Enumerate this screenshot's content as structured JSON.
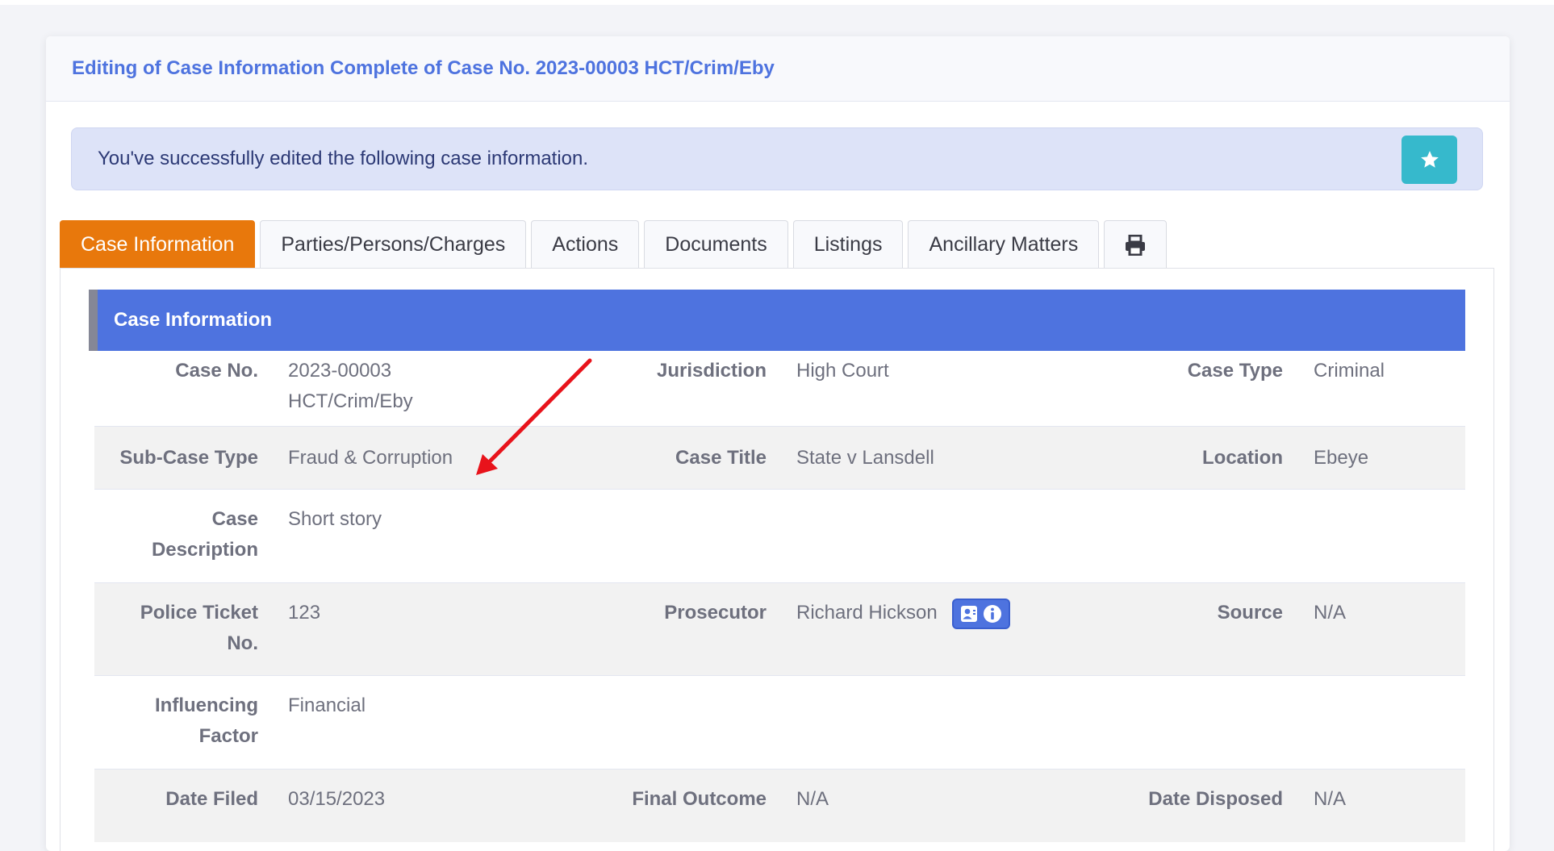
{
  "header": {
    "title": "Editing of Case Information Complete of Case No. 2023-00003 HCT/Crim/Eby"
  },
  "alert": {
    "message": "You've successfully edited the following case information.",
    "icon": "star-icon"
  },
  "tabs": [
    {
      "label": "Case Information",
      "active": true
    },
    {
      "label": "Parties/Persons/Charges"
    },
    {
      "label": "Actions"
    },
    {
      "label": "Documents"
    },
    {
      "label": "Listings"
    },
    {
      "label": "Ancillary Matters"
    },
    {
      "label": "",
      "icon": "print-icon"
    }
  ],
  "section": {
    "title": "Case Information"
  },
  "fields": {
    "case_no": {
      "label": "Case No.",
      "value_line1": "2023-00003",
      "value_line2": "HCT/Crim/Eby"
    },
    "jurisdiction": {
      "label": "Jurisdiction",
      "value": "High Court"
    },
    "case_type": {
      "label": "Case Type",
      "value": "Criminal"
    },
    "sub_case_type": {
      "label": "Sub-Case Type",
      "value": "Fraud & Corruption"
    },
    "case_title": {
      "label": "Case Title",
      "value": "State v Lansdell"
    },
    "location": {
      "label": "Location",
      "value": "Ebeye"
    },
    "case_description": {
      "label_line1": "Case",
      "label_line2": "Description",
      "value": "Short story"
    },
    "police_ticket": {
      "label_line1": "Police Ticket",
      "label_line2": "No.",
      "value": "123"
    },
    "prosecutor": {
      "label": "Prosecutor",
      "value": "Richard Hickson",
      "icons": [
        "contact-card-icon",
        "info-icon"
      ]
    },
    "source": {
      "label": "Source",
      "value": "N/A"
    },
    "influencing_factor": {
      "label_line1": "Influencing",
      "label_line2": "Factor",
      "value": "Financial"
    },
    "date_filed": {
      "label": "Date Filed",
      "value": "03/15/2023"
    },
    "final_outcome": {
      "label": "Final Outcome",
      "value": "N/A"
    },
    "date_disposed": {
      "label": "Date Disposed",
      "value": "N/A"
    }
  },
  "colors": {
    "primary": "#4e73df",
    "active_tab": "#e8780c",
    "star_button": "#36b9cc",
    "annotation_arrow": "#e8131b"
  }
}
